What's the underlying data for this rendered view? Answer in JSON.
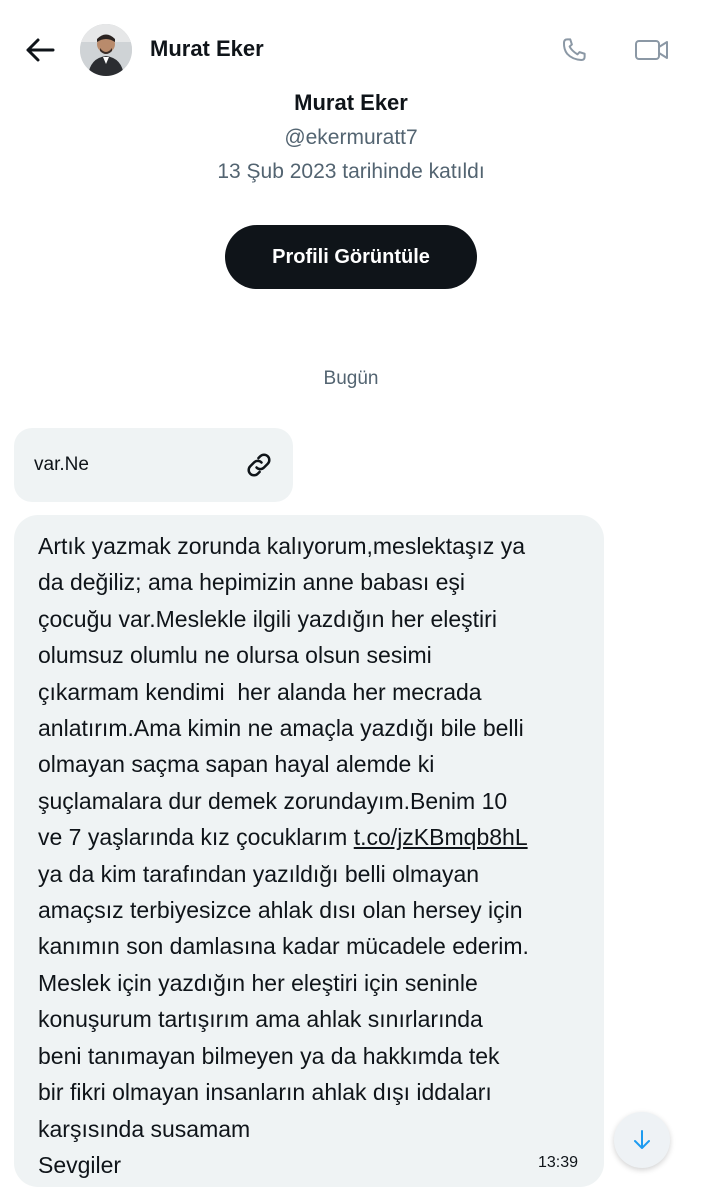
{
  "header": {
    "title": "Murat Eker",
    "back_icon": "arrow-left-icon",
    "call_icon": "phone-icon",
    "video_icon": "video-camera-icon"
  },
  "profile": {
    "name": "Murat Eker",
    "handle": "@ekermuratt7",
    "joined": "13 Şub 2023 tarihinde katıldı",
    "view_button": "Profili Görüntüle"
  },
  "conversation": {
    "date_separator": "Bugün",
    "link_message": {
      "text": "var.Ne",
      "icon": "link-icon"
    },
    "message": {
      "lines": [
        "Artık yazmak zorunda kalıyorum,meslektaşız ya",
        "da değiliz; ama hepimizin anne babası eşi",
        "çocuğu var.Meslekle ilgili yazdığın her eleştiri",
        "olumsuz olumlu ne olursa olsun sesimi",
        "çıkarmam kendimi  her alanda her mecrada",
        "anlatırım.Ama kimin ne amaçla yazdığı bile belli",
        "olmayan saçma sapan hayal alemde ki",
        "şuçlamalara dur demek zorundayım.Benim 10",
        "ve 7 yaşlarında kız çocuklarım "
      ],
      "link": "t.co/jzKBmqb8hL",
      "lines_after": [
        "ya da kim tarafından yazıldığı belli olmayan",
        "amaçsız terbiyesizce ahlak dısı olan hersey için",
        "kanımın son damlasına kadar mücadele ederim.",
        "Meslek için yazdığın her eleştiri için seninle",
        "konuşurum tartışırım ama ahlak sınırlarında",
        "beni tanımayan bilmeyen ya da hakkımda tek",
        "bir fikri olmayan insanların ahlak dışı iddaları",
        "karşısında susamam",
        "Sevgiler"
      ],
      "time": "13:39"
    }
  },
  "scroll_button_icon": "arrow-down-icon",
  "colors": {
    "text": "#0f1419",
    "secondary": "#536471",
    "bubble": "#eff3f4",
    "button": "#0f1419",
    "accent": "#1d9bf0"
  }
}
